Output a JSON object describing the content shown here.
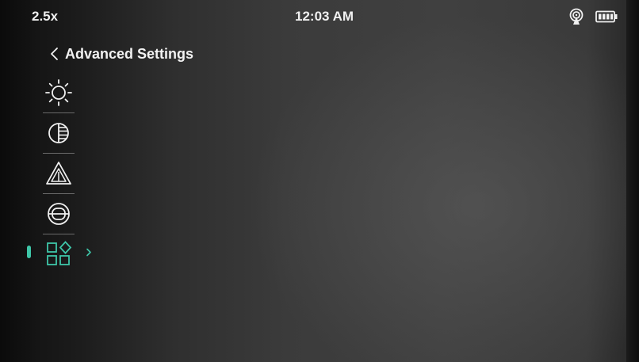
{
  "status_bar": {
    "zoom": "2.5x",
    "time": "12:03 AM",
    "icons": [
      "hotspot-icon",
      "battery-icon"
    ]
  },
  "header": {
    "title": "Advanced Settings",
    "back_icon": "chevron-left-icon"
  },
  "menu": {
    "items": [
      {
        "icon": "brightness-icon",
        "selected": false
      },
      {
        "icon": "contrast-icon",
        "selected": false
      },
      {
        "icon": "sharpness-icon",
        "selected": false
      },
      {
        "icon": "calibration-icon",
        "selected": false
      },
      {
        "icon": "more-apps-icon",
        "selected": true
      }
    ]
  },
  "colors": {
    "accent": "#3ec6a8",
    "text": "#f2f2f2"
  }
}
